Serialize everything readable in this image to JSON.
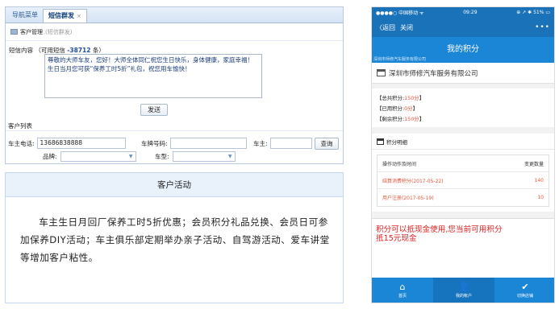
{
  "admin": {
    "tabs": [
      {
        "label": "导航菜单"
      },
      {
        "label": "短信群发",
        "close": "×"
      }
    ],
    "breadcrumb": {
      "module": "客户管理",
      "sub": "(短信群发)"
    },
    "sms": {
      "label_prefix": "短信内容 （可用短信",
      "available": "-38712",
      "label_suffix": "条）",
      "content": "尊敬的大师车友，您好！大师全体同仁祝您生日快乐，身体健康，家庭幸福！生日当月您可获“保养工时5折”礼包，祝您用车愉快！"
    },
    "send_label": "发送",
    "list_title": "客户列表",
    "filters": {
      "phone_label": "车主电话:",
      "phone_value": "13686838888",
      "plate_label": "车牌号码:",
      "plate_value": "",
      "owner_label": "车主:",
      "owner_value": "",
      "brand_label": "品牌:",
      "model_label": "车型:",
      "query_label": "查询"
    }
  },
  "activity": {
    "title": "客户活动",
    "text": "车主生日月回厂保养工时5折优惠；会员积分礼品兑换、会员日可参加保养DIY活动；车主俱乐部定期举办亲子活动、自驾游活动、爱车讲堂等增加客户粘性。"
  },
  "phone": {
    "status_left": "●●●●○ 中国移动 ᯤ",
    "time": "09:29",
    "status_right": "⊕ ↗ ✱ 51% ▭",
    "back_label": "〈返回",
    "close_label": "关闭",
    "more_label": "•••",
    "page_title": "我的积分",
    "page_small": "深圳市师修汽车服务有限公司",
    "company_name": "深圳市师修汽车服务有限公司",
    "points": [
      {
        "label": "【总共积分:",
        "value": "150分",
        "tail": "】"
      },
      {
        "label": "【已用积分:",
        "value": "0分",
        "tail": "】"
      },
      {
        "label": "【剩余积分:",
        "value": "150分",
        "tail": "】"
      }
    ],
    "detail_title": "积分明细",
    "table": {
      "col1": "操作动作及时间",
      "col2": "变更数量",
      "rows": [
        {
          "action": "结算消费积分(2017-05-22)",
          "amount": "140"
        },
        {
          "action": "用户注册(2017-05-19)",
          "amount": "10"
        }
      ]
    },
    "promo_line1": "积分可以抵现金使用,您当前可用积分",
    "promo_line2": "抵15元现金",
    "tabbar": [
      {
        "label": "首页",
        "icon": "⌂"
      },
      {
        "label": "我的帐户",
        "icon": "👤"
      },
      {
        "label": "切换店铺",
        "icon": "✔"
      }
    ]
  }
}
